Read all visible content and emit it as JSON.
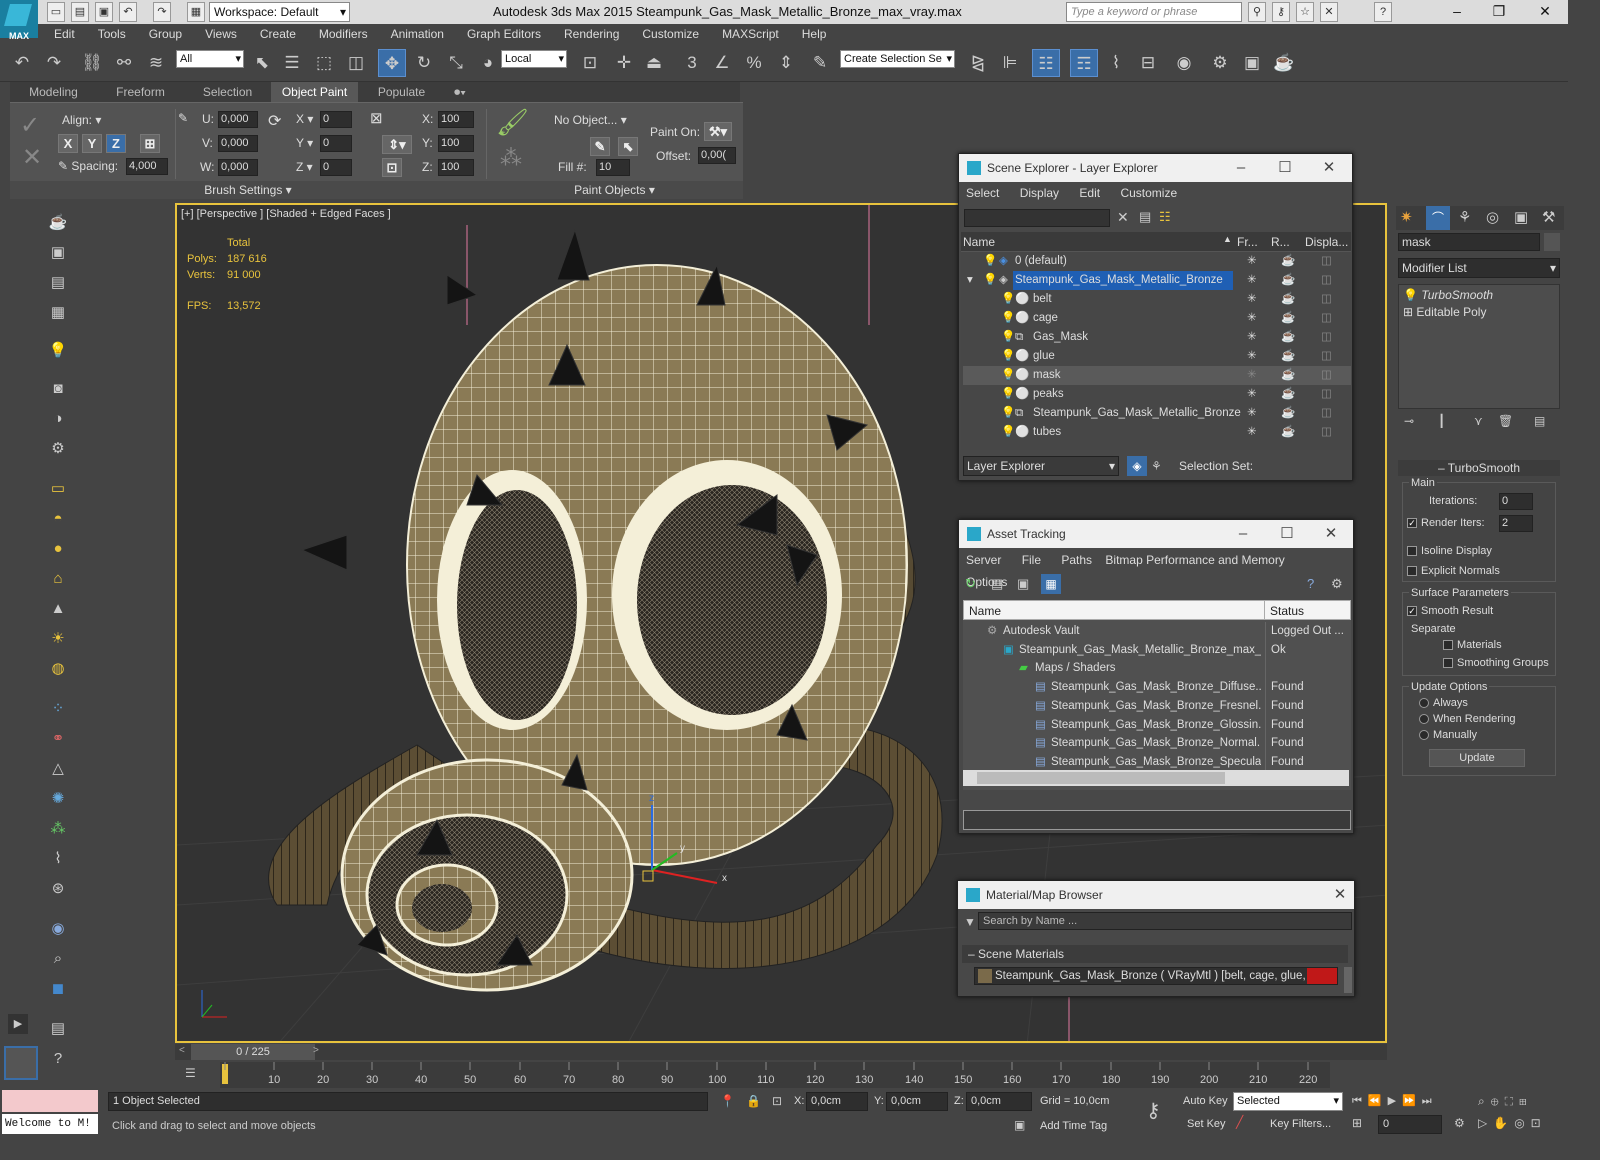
{
  "app": {
    "title": "Autodesk 3ds Max  2015    Steampunk_Gas_Mask_Metallic_Bronze_max_vray.max",
    "workspace": "Workspace: Default",
    "search_placeholder": "Type a keyword or phrase",
    "logo_text": "MAX"
  },
  "menu": [
    "Edit",
    "Tools",
    "Group",
    "Views",
    "Create",
    "Modifiers",
    "Animation",
    "Graph Editors",
    "Rendering",
    "Customize",
    "MAXScript",
    "Help"
  ],
  "toolbar": {
    "filter": "All",
    "coord": "Local",
    "selection_set": "Create Selection Se",
    "snap_3": "3",
    "snap_pct": "%"
  },
  "ribbon": {
    "tabs": [
      "Modeling",
      "Freeform",
      "Selection",
      "Object Paint",
      "Populate"
    ],
    "active_tab": "Object Paint",
    "align_label": "Align:",
    "axis": [
      "X",
      "Y",
      "Z"
    ],
    "spacing_label": "Spacing:",
    "spacing": "4,000",
    "u_label": "U:",
    "u": "0,000",
    "v_label": "V:",
    "v": "0,000",
    "w_label": "W:",
    "w": "0,000",
    "x_label": "X",
    "x": "0",
    "y_label": "Y",
    "y": "0",
    "z_label": "Z",
    "z": "0",
    "sx_label": "X:",
    "sx": "100",
    "sy_label": "Y:",
    "sy": "100",
    "sz_label": "Z:",
    "sz": "100",
    "no_object": "No Object...",
    "fill_label": "Fill #:",
    "fill": "10",
    "paint_on_label": "Paint On:",
    "offset_label": "Offset:",
    "offset": "0,00(",
    "brush_settings": "Brush Settings",
    "paint_objects": "Paint Objects"
  },
  "viewport": {
    "label": "[+] [Perspective ] [Shaded + Edged Faces ]",
    "total_label": "Total",
    "polys_label": "Polys:",
    "polys": "187 616",
    "verts_label": "Verts:",
    "verts": "91 000",
    "fps_label": "FPS:",
    "fps": "13,572",
    "gizmo_x": "x",
    "gizmo_y": "y",
    "gizmo_z": "z"
  },
  "scene_explorer": {
    "title": "Scene Explorer - Layer Explorer",
    "menu": [
      "Select",
      "Display",
      "Edit",
      "Customize"
    ],
    "columns": [
      "Name",
      "Fr...",
      "R...",
      "Displa..."
    ],
    "rows": [
      {
        "name": "0 (default)",
        "level": 0
      },
      {
        "name": "Steampunk_Gas_Mask_Metallic_Bronze",
        "level": 0,
        "selected": true
      },
      {
        "name": "belt",
        "level": 1
      },
      {
        "name": "cage",
        "level": 1
      },
      {
        "name": "Gas_Mask",
        "level": 1
      },
      {
        "name": "glue",
        "level": 1
      },
      {
        "name": "mask",
        "level": 1,
        "highlight": true
      },
      {
        "name": "peaks",
        "level": 1
      },
      {
        "name": "Steampunk_Gas_Mask_Metallic_Bronze",
        "level": 1
      },
      {
        "name": "tubes",
        "level": 1
      }
    ],
    "footer_dropdown": "Layer Explorer",
    "selection_set_label": "Selection Set:"
  },
  "asset_tracking": {
    "title": "Asset Tracking",
    "menu": [
      "Server",
      "File",
      "Paths",
      "Bitmap Performance and Memory",
      "Options"
    ],
    "columns": [
      "Name",
      "Status"
    ],
    "rows": [
      {
        "name": "Autodesk Vault",
        "status": "Logged Out ...",
        "indent": 1
      },
      {
        "name": "Steampunk_Gas_Mask_Metallic_Bronze_max_...",
        "status": "Ok",
        "indent": 2
      },
      {
        "name": "Maps / Shaders",
        "status": "",
        "indent": 3
      },
      {
        "name": "Steampunk_Gas_Mask_Bronze_Diffuse....",
        "status": "Found",
        "indent": 4
      },
      {
        "name": "Steampunk_Gas_Mask_Bronze_Fresnel....",
        "status": "Found",
        "indent": 4
      },
      {
        "name": "Steampunk_Gas_Mask_Bronze_Glossin....",
        "status": "Found",
        "indent": 4
      },
      {
        "name": "Steampunk_Gas_Mask_Bronze_Normal....",
        "status": "Found",
        "indent": 4
      },
      {
        "name": "Steampunk_Gas_Mask_Bronze_Specula....",
        "status": "Found",
        "indent": 4
      }
    ]
  },
  "material_browser": {
    "title": "Material/Map Browser",
    "search_placeholder": "Search by Name ...",
    "section": "Scene Materials",
    "item": "Steampunk_Gas_Mask_Bronze  ( VRayMtl ) [belt, cage, glue, mask..."
  },
  "command_panel": {
    "object_name": "mask",
    "modifier_list": "Modifier List",
    "stack": [
      "TurboSmooth",
      "Editable Poly"
    ],
    "rollout_title": "TurboSmooth",
    "main_label": "Main",
    "iterations_label": "Iterations:",
    "iterations": "0",
    "render_iters_label": "Render Iters:",
    "render_iters": "2",
    "isoline_label": "Isoline Display",
    "explicit_label": "Explicit Normals",
    "surface_label": "Surface Parameters",
    "smooth_result_label": "Smooth Result",
    "separate_label": "Separate",
    "materials_label": "Materials",
    "smoothing_groups_label": "Smoothing Groups",
    "update_options_label": "Update Options",
    "always_label": "Always",
    "when_rendering_label": "When Rendering",
    "manually_label": "Manually",
    "update_button": "Update"
  },
  "timeline": {
    "frame": "0 / 225",
    "ticks": [
      "10",
      "20",
      "30",
      "40",
      "50",
      "60",
      "70",
      "80",
      "90",
      "100",
      "110",
      "120",
      "130",
      "140",
      "150",
      "160",
      "170",
      "180",
      "190",
      "200",
      "210",
      "220"
    ]
  },
  "status": {
    "welcome": "Welcome to M!",
    "selected": "1 Object Selected",
    "prompt": "Click and drag to select and move objects",
    "x_label": "X:",
    "x": "0,0cm",
    "y_label": "Y:",
    "y": "0,0cm",
    "z_label": "Z:",
    "z": "0,0cm",
    "grid": "Grid = 10,0cm",
    "add_time_tag": "Add Time Tag",
    "auto_key": "Auto Key",
    "set_key": "Set Key",
    "key_mode": "Selected",
    "key_filters": "Key Filters...",
    "frame_field": "0"
  },
  "colors": {
    "accent_blue": "#3a6ea8",
    "viewport_border": "#e8c33d",
    "selection_highlight": "#1f5fb4",
    "mask_bronze": "#8a7a55"
  }
}
